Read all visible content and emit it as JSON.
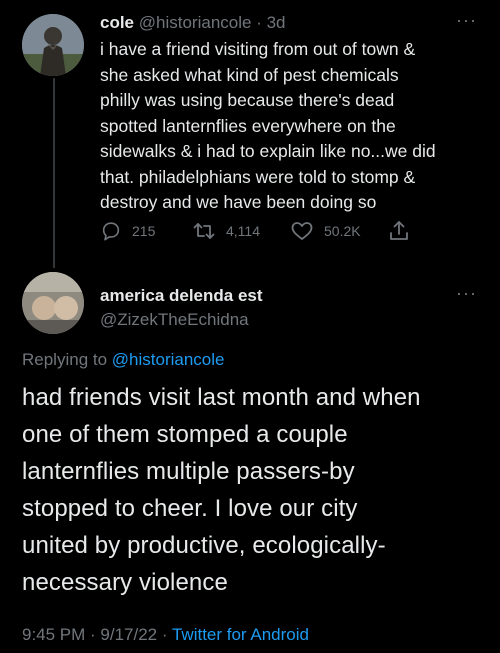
{
  "tweet1": {
    "display_name": "cole",
    "handle": "@historiancole",
    "time_sep": " · ",
    "time": "3d",
    "more": "···",
    "lines": [
      "i have a friend visiting from out of town &",
      "she asked what kind of pest chemicals",
      "philly was using because there's dead",
      "spotted lanternflies everywhere on the",
      "sidewalks & i had to explain like no...we did",
      "that. philadelphians were told to stomp &",
      "destroy and we have been doing so"
    ],
    "replies": "215",
    "retweets": "4,114",
    "likes": "50.2K"
  },
  "tweet2": {
    "display_name": "america delenda est",
    "handle": "@ZizekTheEchidna",
    "more": "···",
    "replying_prefix": "Replying to ",
    "replying_handle": "@historiancole",
    "lines": [
      "had friends visit last month and when",
      "one of them stomped a couple",
      "lanternflies multiple passers-by",
      "stopped to cheer. I love our city",
      "united by productive, ecologically-",
      "necessary violence"
    ],
    "time": "9:45 PM",
    "date_sep": " · ",
    "date": "9/17/22",
    "source_sep": " · ",
    "source": "Twitter for Android"
  },
  "colors": {
    "background": "#000000",
    "text": "#e7e9ea",
    "muted": "#71767b",
    "link": "#1d9bf0",
    "divider": "#2f3336"
  }
}
